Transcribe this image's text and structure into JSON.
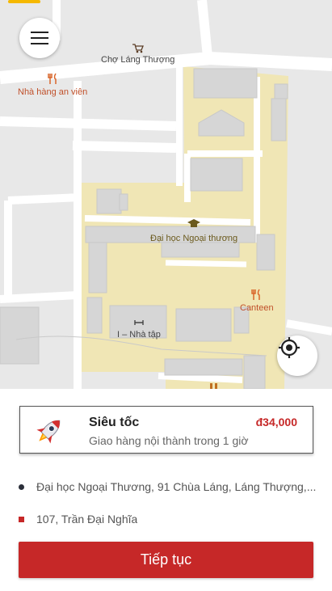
{
  "map": {
    "labels": {
      "market": "Chợ Láng Thượng",
      "restaurant": "Nhà hàng an viên",
      "university": "Đại học Ngoại thương",
      "canteen": "Canteen",
      "building": "I – Nhà tập"
    }
  },
  "service": {
    "name": "Siêu tốc",
    "description": "Giao hàng nội thành trong 1 giờ",
    "price": "đ34,000"
  },
  "route": {
    "pickup": "Đại học Ngoại Thương, 91 Chùa Láng, Láng Thượng,...",
    "dropoff": "107, Trần Đại Nghĩa"
  },
  "actions": {
    "continue_label": "Tiếp tục"
  },
  "colors": {
    "accent": "#c62828",
    "campus": "#f0e6b5",
    "map_bg": "#e8e8e8"
  }
}
